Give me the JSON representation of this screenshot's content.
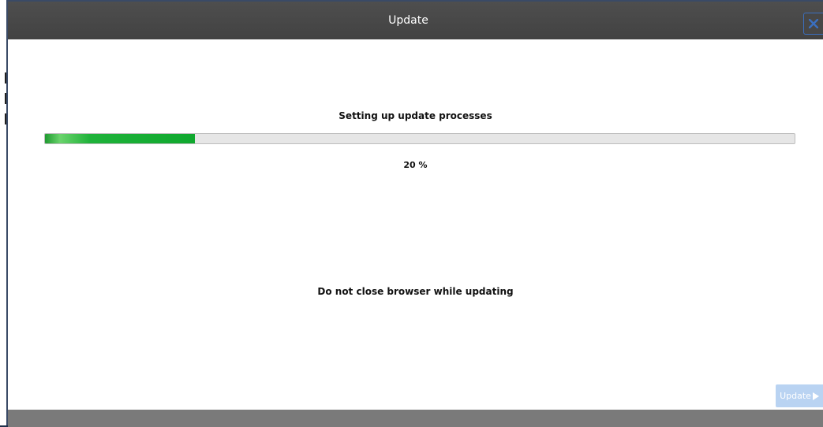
{
  "dialog": {
    "title": "Update",
    "close_icon": "close-icon",
    "accent_color": "#3b6fbf"
  },
  "progress": {
    "status": "Setting up update processes",
    "value_percent": 20,
    "label": "20 %",
    "fill_color": "#0fa82e"
  },
  "warning": "Do not close browser while updating",
  "actions": {
    "update_label": "Update",
    "update_icon": "play-icon",
    "update_enabled": false
  }
}
